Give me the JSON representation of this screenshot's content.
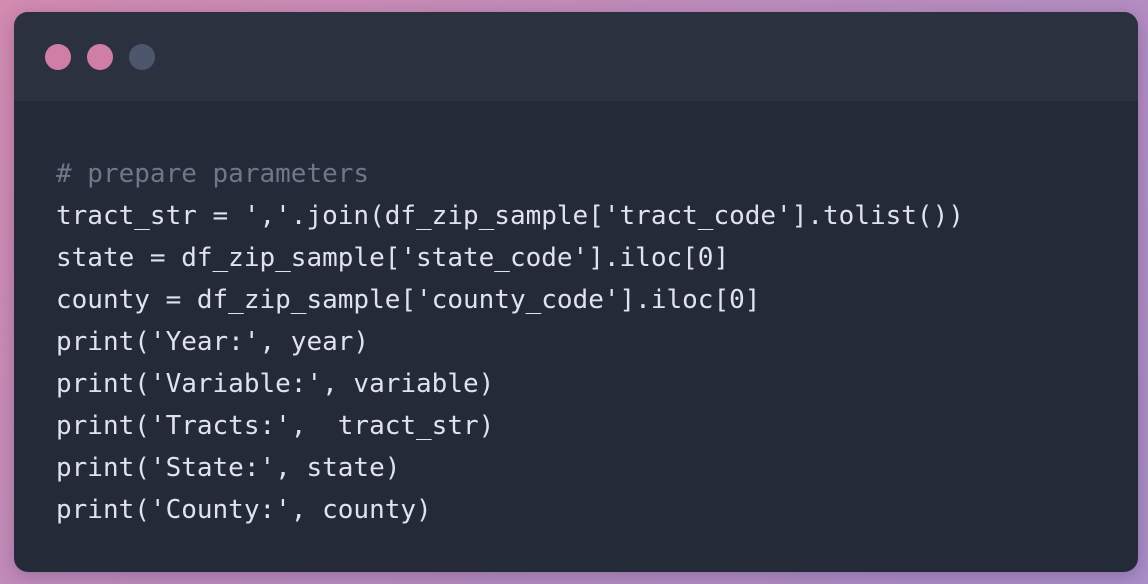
{
  "window": {
    "controls": [
      {
        "name": "close",
        "color": "#cf7fa6"
      },
      {
        "name": "minimize",
        "color": "#cf7fa6"
      },
      {
        "name": "maximize",
        "color": "#4d566c"
      }
    ]
  },
  "code": {
    "lines": [
      "# prepare parameters",
      "tract_str = ','.join(df_zip_sample['tract_code'].tolist())",
      "state = df_zip_sample['state_code'].iloc[0]",
      "county = df_zip_sample['county_code'].iloc[0]",
      "print('Year:', year)",
      "print('Variable:', variable)",
      "print('Tracts:',  tract_str)",
      "print('State:', state)",
      "print('County:', county)"
    ]
  },
  "colors": {
    "background_gradient": [
      "#d38bb0",
      "#a98ec8"
    ],
    "window_bg": "#242a37",
    "titlebar_bg": "#2b313e",
    "code_text": "#dfe3ee",
    "comment_text": "#6f7788"
  }
}
